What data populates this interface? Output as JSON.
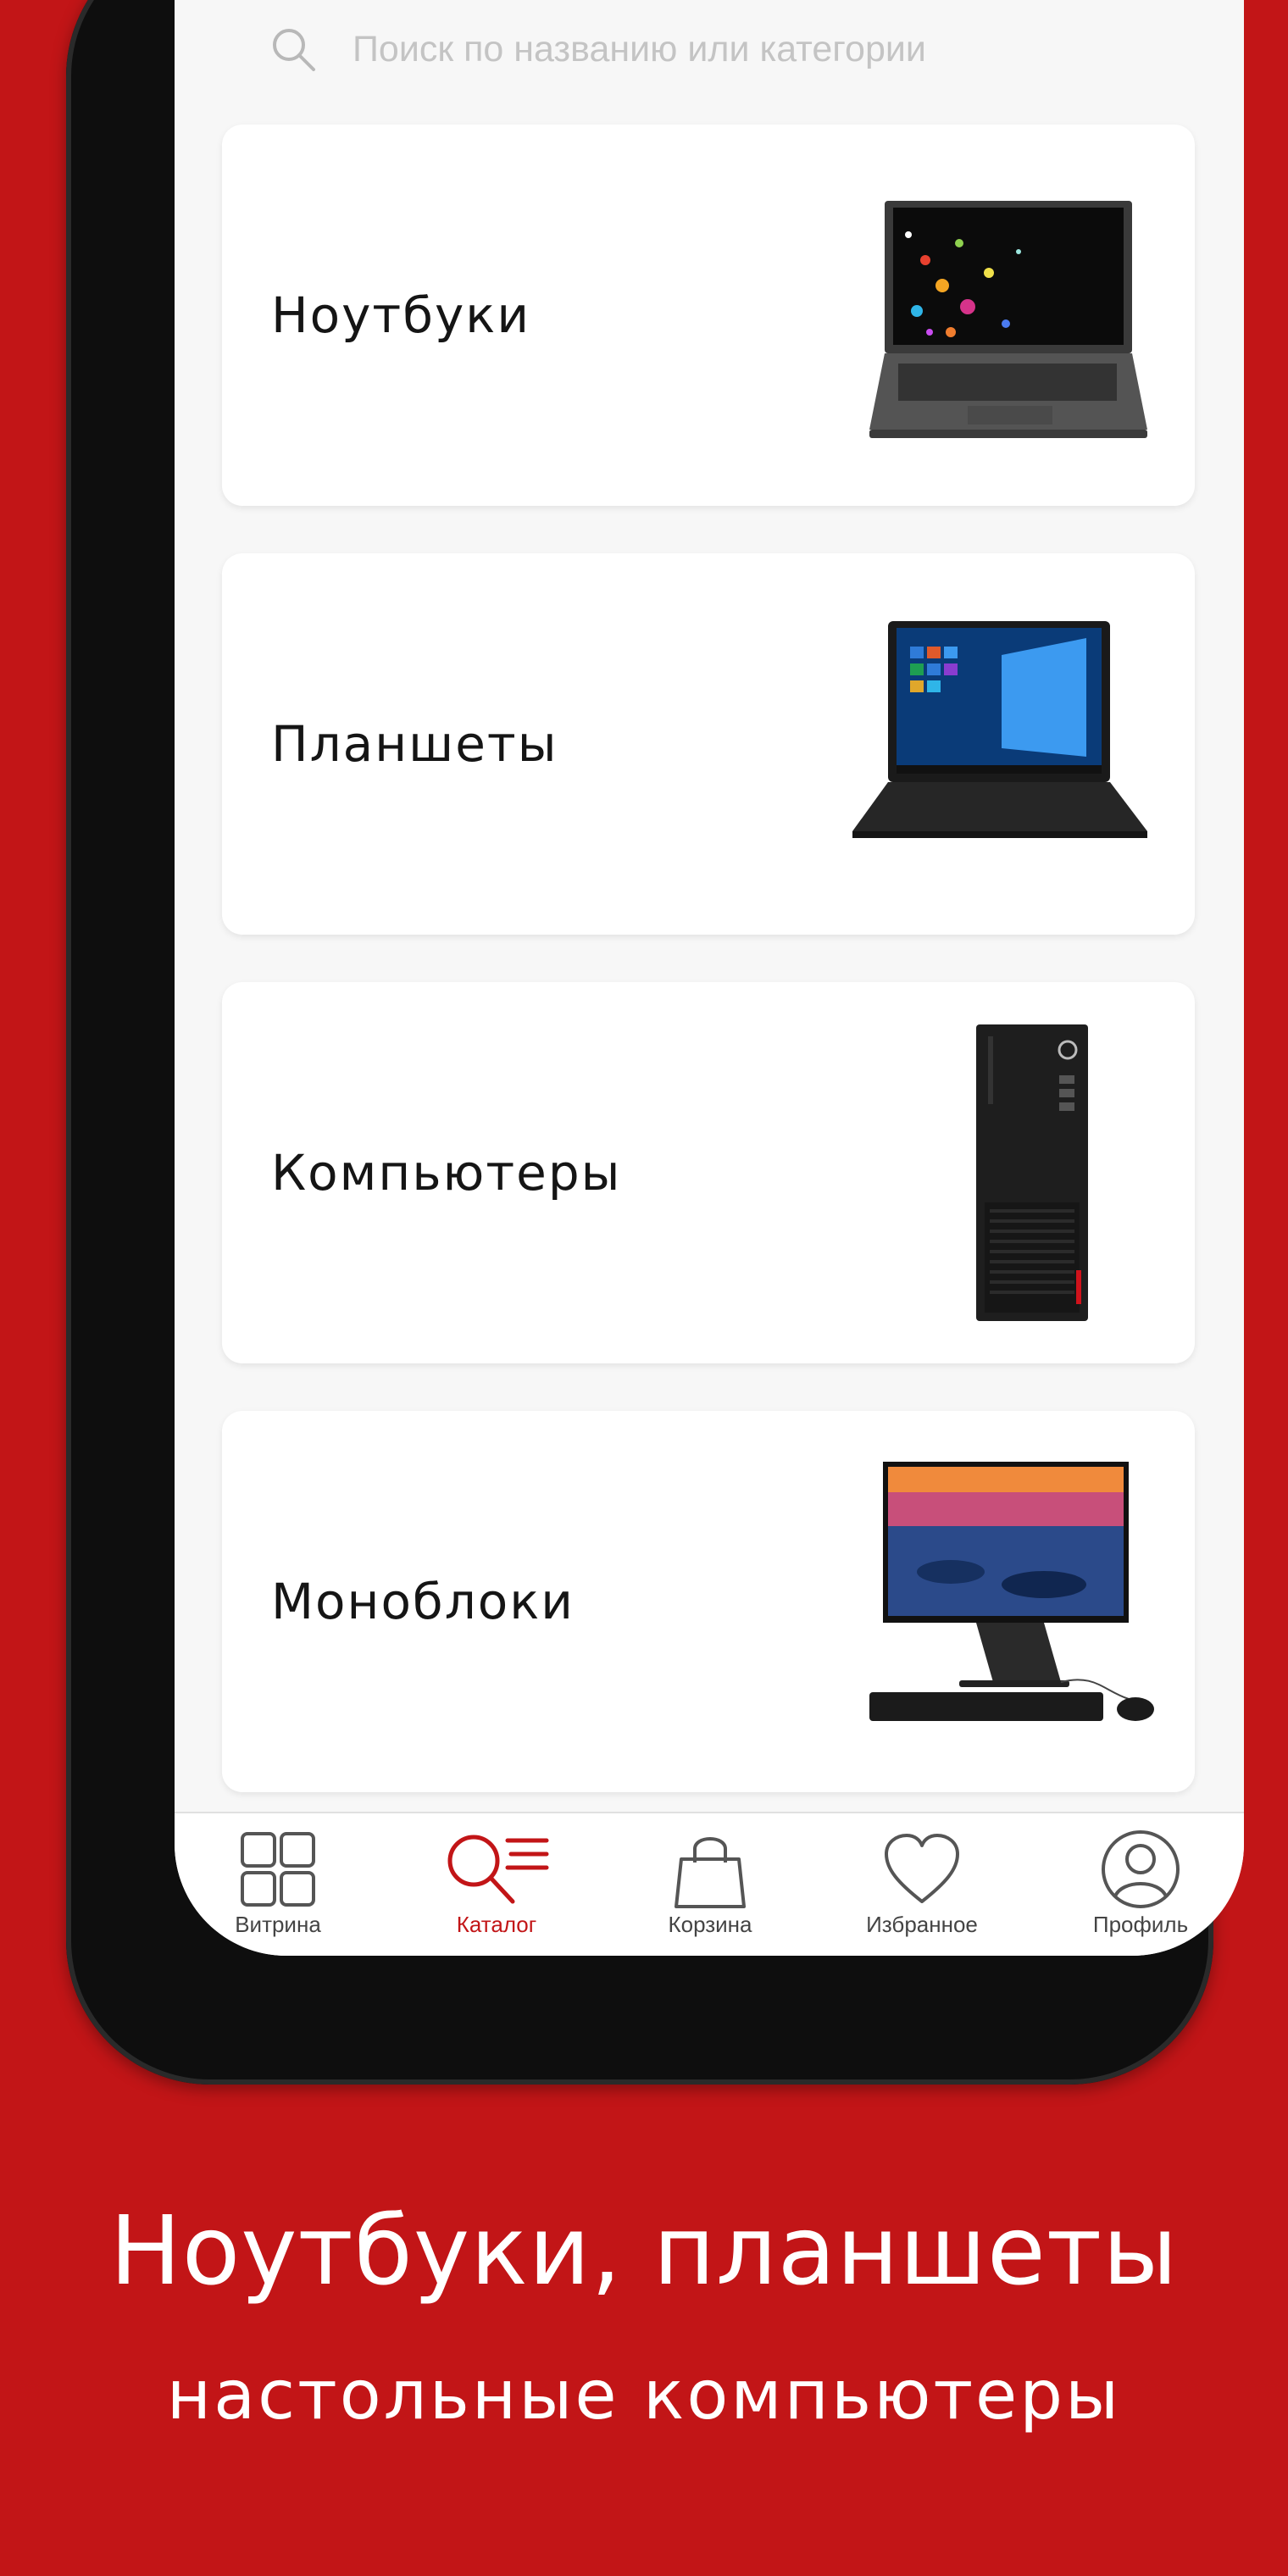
{
  "search": {
    "placeholder": "Поиск по названию или категории",
    "icon": "search-icon"
  },
  "categories": [
    {
      "label": "Ноутбуки",
      "image": "laptop-image"
    },
    {
      "label": "Планшеты",
      "image": "tablet-image"
    },
    {
      "label": "Компьютеры",
      "image": "desktop-tower-image"
    },
    {
      "label": "Моноблоки",
      "image": "all-in-one-image"
    }
  ],
  "tabbar": {
    "items": [
      {
        "label": "Витрина",
        "icon": "grid-icon"
      },
      {
        "label": "Каталог",
        "icon": "catalog-search-icon",
        "active": true
      },
      {
        "label": "Корзина",
        "icon": "shopping-bag-icon"
      },
      {
        "label": "Избранное",
        "icon": "heart-icon"
      },
      {
        "label": "Профиль",
        "icon": "profile-icon"
      }
    ]
  },
  "caption": {
    "line1": "Ноутбуки, планшеты",
    "line2": "настольные компьютеры"
  },
  "colors": {
    "brand_red": "#c21517",
    "screen_bg": "#f7f7f7",
    "text": "#151515"
  }
}
